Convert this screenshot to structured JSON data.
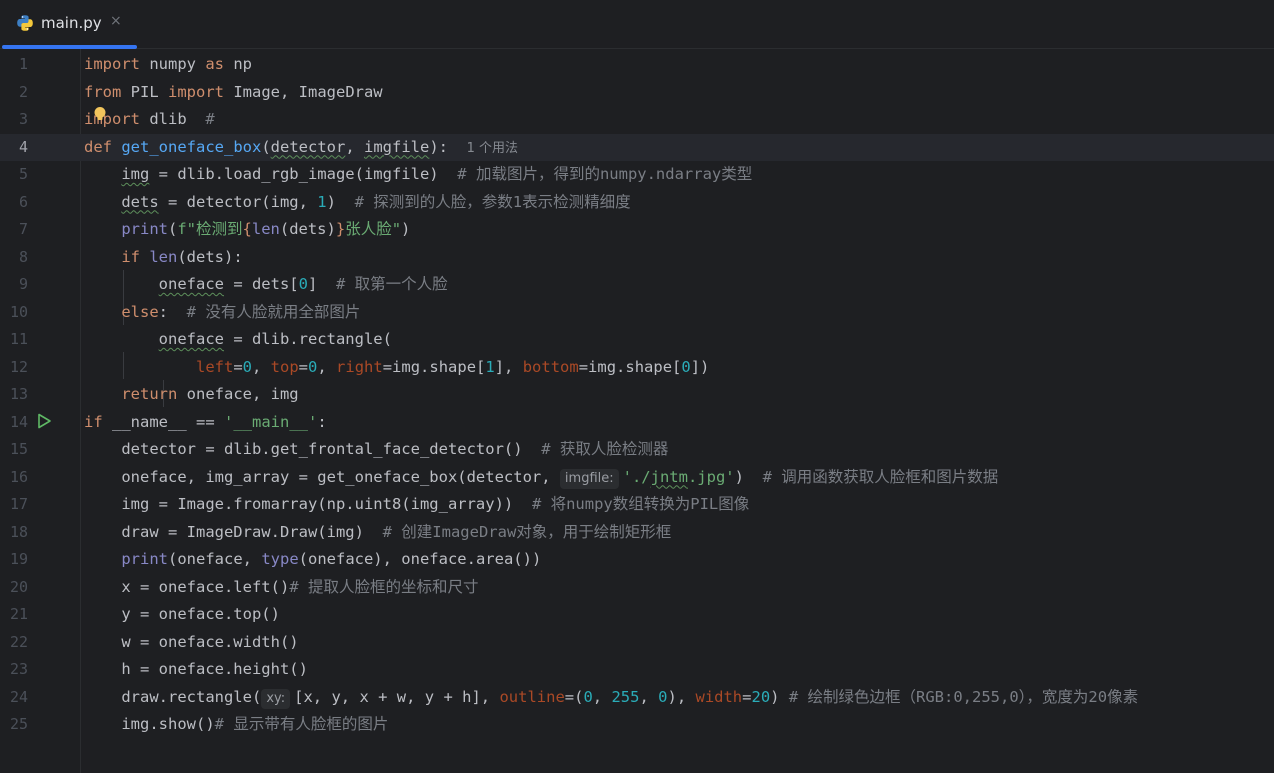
{
  "tab": {
    "label": "main.py",
    "close_glyph": "×",
    "icon": "python-icon"
  },
  "lines": [
    {
      "n": "1"
    },
    {
      "n": "2"
    },
    {
      "n": "3"
    },
    {
      "n": "4"
    },
    {
      "n": "5"
    },
    {
      "n": "6"
    },
    {
      "n": "7"
    },
    {
      "n": "8"
    },
    {
      "n": "9"
    },
    {
      "n": "10"
    },
    {
      "n": "11"
    },
    {
      "n": "12"
    },
    {
      "n": "13"
    },
    {
      "n": "14"
    },
    {
      "n": "15"
    },
    {
      "n": "16"
    },
    {
      "n": "17"
    },
    {
      "n": "18"
    },
    {
      "n": "19"
    },
    {
      "n": "20"
    },
    {
      "n": "21"
    },
    {
      "n": "22"
    },
    {
      "n": "23"
    },
    {
      "n": "24"
    },
    {
      "n": "25"
    }
  ],
  "code": {
    "l1": {
      "a": "import",
      "b": " numpy ",
      "c": "as",
      "d": " np"
    },
    "l2": {
      "a": "from",
      "b": " PIL ",
      "c": "import",
      "d": " Image, ImageDraw"
    },
    "l3": {
      "a": "import",
      "b": " dlib  ",
      "c": "#"
    },
    "l4": {
      "a": "def",
      "b": " ",
      "c": "get_oneface_box",
      "d": "(",
      "e": "detector",
      "f": ", ",
      "g": "imgfile",
      "h": "):  ",
      "hint": "1 个用法"
    },
    "l5": {
      "a": "    ",
      "b": "img",
      "c": " = dlib.load_rgb_image(imgfile)  ",
      "d": "# 加载图片，得到的numpy.ndarray类型"
    },
    "l6": {
      "a": "    ",
      "b": "dets",
      "c": " = detector(img, ",
      "d": "1",
      "e": ")  ",
      "f": "# 探测到的人脸，参数1表示检测精细度"
    },
    "l7": {
      "a": "    ",
      "b": "print",
      "c": "(",
      "d": "f\"检测到",
      "e": "{",
      "f": "len",
      "g": "(dets)",
      "h": "}",
      "i": "张人脸\"",
      "j": ")"
    },
    "l8": {
      "a": "    ",
      "b": "if",
      "c": " ",
      "d": "len",
      "e": "(dets):"
    },
    "l9": {
      "a": "        ",
      "b": "oneface",
      "c": " = dets[",
      "d": "0",
      "e": "]  ",
      "f": "# 取第一个人脸"
    },
    "l10": {
      "a": "    ",
      "b": "else",
      "c": ":  ",
      "d": "# 没有人脸就用全部图片"
    },
    "l11": {
      "a": "        ",
      "b": "oneface",
      "c": " = dlib.rectangle("
    },
    "l12": {
      "a": "            ",
      "b": "left",
      "c": "=",
      "d": "0",
      "e": ", ",
      "f": "top",
      "g": "=",
      "h": "0",
      "i": ", ",
      "j": "right",
      "k": "=img.shape[",
      "l": "1",
      "m": "], ",
      "n": "bottom",
      "o": "=img.shape[",
      "p": "0",
      "q": "])"
    },
    "l13": {
      "a": "    ",
      "b": "return",
      "c": " oneface, img"
    },
    "l14": {
      "a": "if",
      "b": " __name__ == ",
      "c": "'__main__'",
      "d": ":"
    },
    "l15": {
      "a": "    detector = dlib.get_frontal_face_detector()  ",
      "b": "# 获取人脸检测器"
    },
    "l16": {
      "a": "    oneface, img_array = get_oneface_box(detector, ",
      "inlay": "imgfile:",
      "b": "'./",
      "c": "jntm",
      "d": ".jpg'",
      "e": ")  ",
      "f": "# 调用函数获取人脸框和图片数据"
    },
    "l17": {
      "a": "    img = Image.fromarray(np.uint8(img_array))  ",
      "b": "# 将numpy数组转换为PIL图像"
    },
    "l18": {
      "a": "    draw = ImageDraw.Draw(img)  ",
      "b": "# 创建ImageDraw对象，用于绘制矩形框"
    },
    "l19": {
      "a": "    ",
      "b": "print",
      "c": "(oneface, ",
      "d": "type",
      "e": "(oneface), oneface.area())"
    },
    "l20": {
      "a": "    x = oneface.left()",
      "b": "# 提取人脸框的坐标和尺寸"
    },
    "l21": {
      "a": "    y = oneface.top()"
    },
    "l22": {
      "a": "    w = oneface.width()"
    },
    "l23": {
      "a": "    h = oneface.height()"
    },
    "l24": {
      "a": "    draw.rectangle(",
      "inlay": "xy:",
      "b": "[x, y, x + w, y + h], ",
      "c": "outline",
      "d": "=(",
      "e": "0",
      "f": ", ",
      "g": "255",
      "h": ", ",
      "i": "0",
      "j": "), ",
      "k": "width",
      "l": "=",
      "m": "20",
      "n": ") ",
      "o": "# 绘制绿色边框（RGB:0,255,0），宽度为20像素"
    },
    "l25": {
      "a": "    img.show()",
      "b": "# 显示带有人脸框的图片"
    }
  },
  "colors": {
    "background": "#1e1f22",
    "keyword": "#cf8e6d",
    "function": "#56a8f5",
    "number": "#2aacb8",
    "string": "#6aab73",
    "comment": "#7a7e85",
    "builtin": "#8888c6",
    "param": "#aa4926",
    "accent": "#3574f0"
  },
  "gutter_icons": {
    "line3": "lightbulb-icon",
    "line14": "run-icon"
  }
}
